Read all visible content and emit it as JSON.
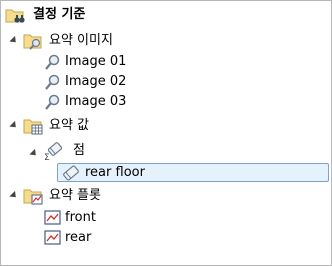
{
  "tree": {
    "root": {
      "label": "결정 기준",
      "icon": "binoculars-folder-icon"
    },
    "summary_images": {
      "label": "요약 이미지",
      "icon": "folder-search-icon",
      "items": [
        {
          "label": "Image 01",
          "icon": "magnifier-icon"
        },
        {
          "label": "Image 02",
          "icon": "magnifier-icon"
        },
        {
          "label": "Image 03",
          "icon": "magnifier-icon"
        }
      ]
    },
    "summary_values": {
      "label": "요약 값",
      "icon": "folder-table-icon",
      "point": {
        "label": "점",
        "icon": "sigma-point-icon",
        "items": [
          {
            "label": "rear floor",
            "icon": "point-shape-icon",
            "selected": true
          }
        ]
      }
    },
    "summary_plots": {
      "label": "요약 플롯",
      "icon": "folder-plot-icon",
      "items": [
        {
          "label": "front",
          "icon": "plot-icon"
        },
        {
          "label": "rear",
          "icon": "plot-icon"
        }
      ]
    }
  },
  "colors": {
    "selection_fill": "#e6f2fb",
    "selection_border": "#7da2ce",
    "folder_yellow": "#f5d88a",
    "plot_line": "#d03030"
  }
}
